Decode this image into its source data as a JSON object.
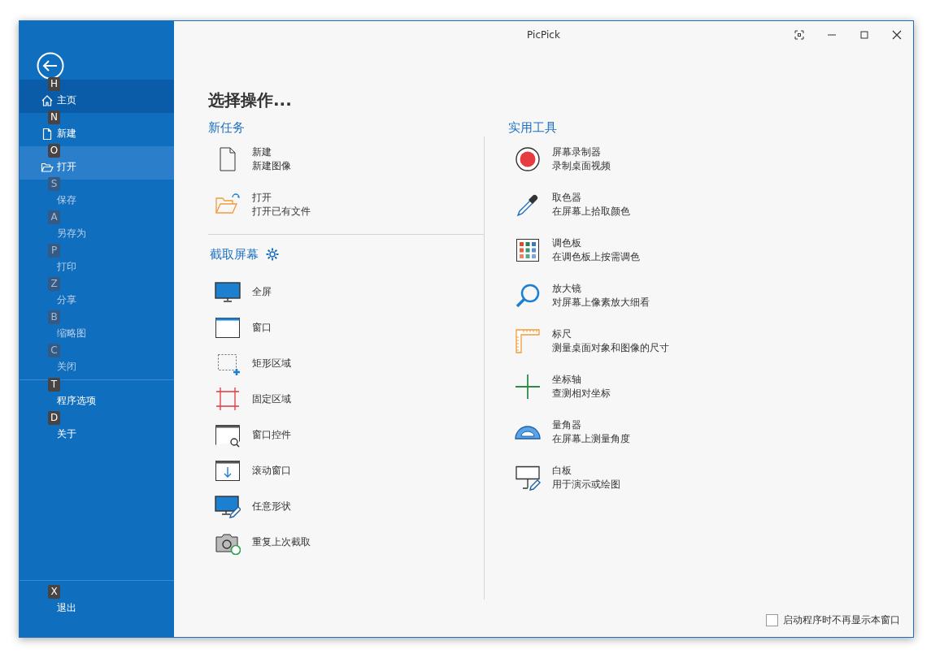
{
  "window": {
    "title": "PicPick"
  },
  "sidebar": {
    "sections": [
      {
        "items": [
          {
            "key": "H",
            "label": "主页",
            "kind": "home",
            "selected": true,
            "hovered": false,
            "disabled": false
          },
          {
            "key": "N",
            "label": "新建",
            "kind": "file",
            "selected": false,
            "hovered": false,
            "disabled": false
          },
          {
            "key": "O",
            "label": "打开",
            "kind": "folder",
            "selected": false,
            "hovered": true,
            "disabled": false
          },
          {
            "key": "S",
            "label": "保存",
            "kind": "plain",
            "selected": false,
            "hovered": false,
            "disabled": true
          },
          {
            "key": "A",
            "label": "另存为",
            "kind": "plain",
            "selected": false,
            "hovered": false,
            "disabled": true
          },
          {
            "key": "P",
            "label": "打印",
            "kind": "plain",
            "selected": false,
            "hovered": false,
            "disabled": true
          },
          {
            "key": "Z",
            "label": "分享",
            "kind": "plain",
            "selected": false,
            "hovered": false,
            "disabled": true
          },
          {
            "key": "B",
            "label": "缩略图",
            "kind": "plain",
            "selected": false,
            "hovered": false,
            "disabled": true
          },
          {
            "key": "C",
            "label": "关闭",
            "kind": "plain",
            "selected": false,
            "hovered": false,
            "disabled": true
          }
        ]
      },
      {
        "items": [
          {
            "key": "T",
            "label": "程序选项",
            "kind": "plain",
            "selected": false,
            "hovered": false,
            "disabled": false
          },
          {
            "key": "D",
            "label": "关于",
            "kind": "plain",
            "selected": false,
            "hovered": false,
            "disabled": false
          }
        ]
      },
      {
        "items": [
          {
            "key": "X",
            "label": "退出",
            "kind": "plain",
            "selected": false,
            "hovered": false,
            "disabled": false
          }
        ]
      }
    ]
  },
  "main": {
    "title": "选择操作...",
    "new_task": {
      "heading": "新任务",
      "items": [
        {
          "kind": "new",
          "title": "新建",
          "subtitle": "新建图像"
        },
        {
          "kind": "open",
          "title": "打开",
          "subtitle": "打开已有文件"
        }
      ]
    },
    "capture": {
      "heading": "截取屏幕",
      "items": [
        {
          "kind": "fullscreen",
          "label": "全屏"
        },
        {
          "kind": "window",
          "label": "窗口"
        },
        {
          "kind": "region",
          "label": "矩形区域"
        },
        {
          "kind": "fixed",
          "label": "固定区域"
        },
        {
          "kind": "control",
          "label": "窗口控件"
        },
        {
          "kind": "scroll",
          "label": "滚动窗口"
        },
        {
          "kind": "freehand",
          "label": "任意形状"
        },
        {
          "kind": "repeat",
          "label": "重复上次截取"
        }
      ]
    },
    "tools": {
      "heading": "实用工具",
      "items": [
        {
          "kind": "recorder",
          "title": "屏幕录制器",
          "subtitle": "录制桌面视频"
        },
        {
          "kind": "picker",
          "title": "取色器",
          "subtitle": "在屏幕上拾取颜色"
        },
        {
          "kind": "palette",
          "title": "调色板",
          "subtitle": "在调色板上按需调色"
        },
        {
          "kind": "magnifier",
          "title": "放大镜",
          "subtitle": "对屏幕上像素放大细看"
        },
        {
          "kind": "ruler",
          "title": "标尺",
          "subtitle": "测量桌面对象和图像的尺寸"
        },
        {
          "kind": "crosshair",
          "title": "坐标轴",
          "subtitle": "查测相对坐标"
        },
        {
          "kind": "protractor",
          "title": "量角器",
          "subtitle": "在屏幕上测量角度"
        },
        {
          "kind": "whiteboard",
          "title": "白板",
          "subtitle": "用于演示或绘图"
        }
      ]
    }
  },
  "footer": {
    "checkbox": {
      "label": "启动程序时不再显示本窗口",
      "checked": false
    }
  }
}
